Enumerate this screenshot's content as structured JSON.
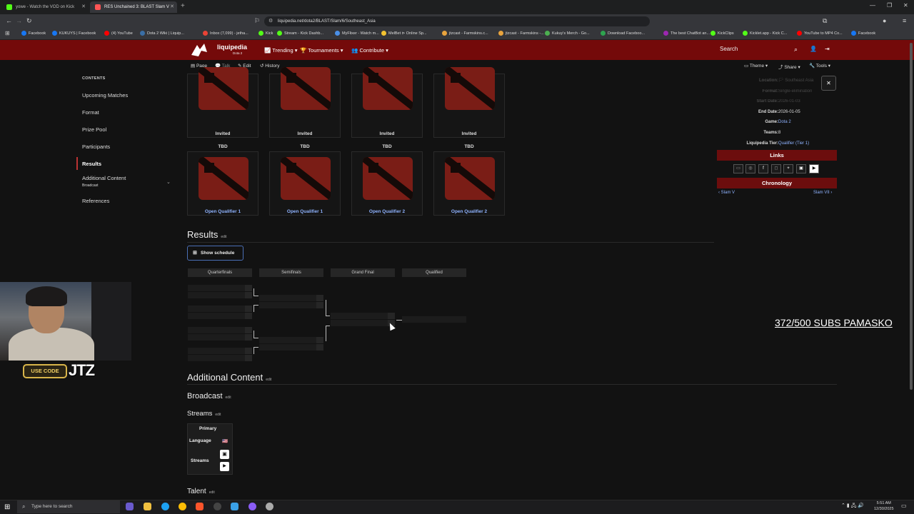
{
  "browser": {
    "tabs": [
      {
        "title": "yowe - Watch the VOD on Kick",
        "color": "#53fc18"
      },
      {
        "title": "RES Unchained 3: BLAST Slam V",
        "color": "#ff5555"
      }
    ],
    "new_tab_symbol": "+",
    "window_controls": [
      "—",
      "❐",
      "✕"
    ],
    "url": "liquipedia.net/dota2/BLAST/Slam/6/Southeast_Asia",
    "bookmarks": [
      {
        "label": "Facebook",
        "color": "#1877f2"
      },
      {
        "label": "KUKUYS | Facebook",
        "color": "#1877f2"
      },
      {
        "label": "(4) YouTube",
        "color": "#ff0000"
      },
      {
        "label": "Dota 2 Wiki | Liquip...",
        "color": "#3a6ea5"
      },
      {
        "label": "Inbox (7,099) - jetha...",
        "color": "#ea4335"
      },
      {
        "label": "Kick",
        "color": "#53fc18"
      },
      {
        "label": "Stream - Kick Dashb...",
        "color": "#53fc18"
      },
      {
        "label": "MyFlixer - Watch m...",
        "color": "#4a8fe7"
      },
      {
        "label": "MelBet ⊳ Online Sp...",
        "color": "#f2c230"
      },
      {
        "label": "jtzcast - Farmskins.c...",
        "color": "#e8a33d"
      },
      {
        "label": "jtzcast - Farmskins -...",
        "color": "#e8a33d"
      },
      {
        "label": "Kukuy's Merch - Go...",
        "color": "#4caf50"
      },
      {
        "label": "Download Faceboo...",
        "color": "#2ea44f"
      },
      {
        "label": "The best ChatBot an...",
        "color": "#9c27b0"
      },
      {
        "label": "KickClips",
        "color": "#53fc18"
      },
      {
        "label": "Kicklet.app - Kick C...",
        "color": "#53fc18"
      },
      {
        "label": "YouTube to MP4 Co...",
        "color": "#ff0000"
      },
      {
        "label": "Facebook",
        "color": "#1877f2"
      }
    ]
  },
  "site": {
    "logo_text": "liquipedia",
    "logo_sub": "Dota 2",
    "nav": [
      "Trending ▾",
      "Tournaments ▾",
      "Contribute ▾"
    ],
    "search_label": "Search",
    "page_actions": [
      "Page",
      "Talk",
      "Edit",
      "History"
    ],
    "right_actions": [
      "Theme ▾",
      "Share ▾",
      "Tools ▾"
    ]
  },
  "toc": {
    "title": "CONTENTS",
    "items": [
      "Upcoming Matches",
      "Format",
      "Prize Pool",
      "Participants",
      "Results",
      "Additional Content",
      "Broadcast",
      "References"
    ],
    "active": "Results"
  },
  "participants": {
    "row1_labels": [
      "Invited",
      "Invited",
      "Invited",
      "Invited"
    ],
    "row2_headers": [
      "TBD",
      "TBD",
      "TBD",
      "TBD"
    ],
    "row2_labels": [
      "Open Qualifier 1",
      "Open Qualifier 1",
      "Open Qualifier 2",
      "Open Qualifier 2"
    ]
  },
  "results": {
    "heading": "Results",
    "edit": "edit",
    "show_schedule": "Show schedule",
    "rounds": [
      "Quarterfinals",
      "Semifinals",
      "Grand Final",
      "Qualified"
    ]
  },
  "additional": {
    "heading": "Additional Content",
    "broadcast": "Broadcast",
    "streams": "Streams",
    "talent": "Talent",
    "edit": "edit",
    "table": {
      "header": "Primary",
      "language_label": "Language",
      "streams_label": "Streams",
      "flag": "🇺🇸"
    }
  },
  "infobox": {
    "faded_rows": [
      {
        "k": "Location:",
        "v": "🏳 Southeast Asia"
      },
      {
        "k": "Format:",
        "v": "Single-elimination"
      },
      {
        "k": "Start Date:",
        "v": "2026-01-03"
      }
    ],
    "rows": [
      {
        "k": "End Date:",
        "v": "2026-01-05"
      },
      {
        "k": "Game:",
        "v": "Dota 2"
      },
      {
        "k": "Teams:",
        "v": "8"
      },
      {
        "k": "Liquipedia Tier:",
        "v": "Qualifier (Tier 1)"
      }
    ],
    "links_title": "Links",
    "chronology_title": "Chronology",
    "prev": "Slam V",
    "next": "Slam VII",
    "close": "✕"
  },
  "overlay": {
    "use_code": "USE CODE",
    "code": "JTZ",
    "subs": "372/500 SUBS PAMASKO"
  },
  "taskbar": {
    "search_placeholder": "Type here to search",
    "time": "5:51 AM",
    "date": "12/30/2025"
  }
}
